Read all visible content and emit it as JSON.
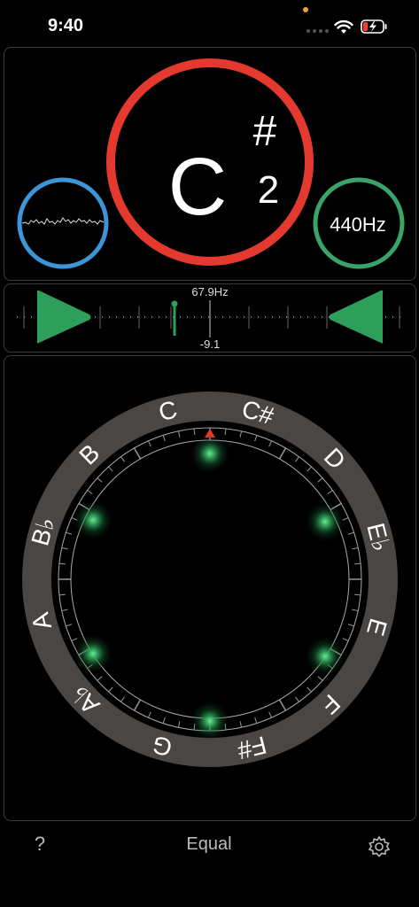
{
  "status_bar": {
    "time": "9:40"
  },
  "note": {
    "name": "C",
    "accidental": "#",
    "octave": "2"
  },
  "reference": {
    "label": "440Hz"
  },
  "meter": {
    "frequency": "67.9Hz",
    "cents": "-9.1"
  },
  "wheel": {
    "notes": [
      "C",
      "C#",
      "D",
      "E♭",
      "E",
      "F",
      "F#",
      "G",
      "A♭",
      "A",
      "B♭",
      "B"
    ]
  },
  "toolbar": {
    "help_label": "?",
    "temperament": "Equal"
  },
  "colors": {
    "note_ring": "#e3392e",
    "wave_ring": "#3d94d6",
    "ref_ring": "#3aa36a",
    "arrows": "#2e9e5b"
  },
  "icons": [
    "wifi-icon",
    "battery-charging-icon",
    "help-icon",
    "gear-icon",
    "triangle-marker-icon"
  ]
}
